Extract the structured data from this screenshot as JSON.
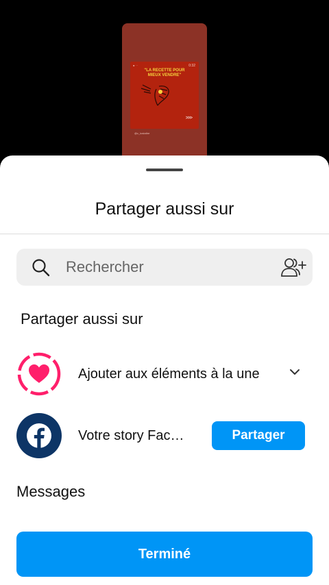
{
  "story_preview": {
    "time": "0:32",
    "headline_line1": "\"LA RECETTE POUR",
    "headline_line2": "MIEUX VENDRE\"",
    "arrows": ">>>",
    "handle": "@c_lustaltre"
  },
  "sheet": {
    "title": "Partager aussi sur",
    "search": {
      "placeholder": "Rechercher"
    },
    "section_heading": "Partager aussi sur",
    "highlights": {
      "label": "Ajouter aux éléments à la une",
      "accent": "#ff1f6b"
    },
    "facebook": {
      "label": "Votre story Facebook",
      "button_label": "Partager",
      "brand": "#0d3566"
    },
    "messages_heading": "Messages",
    "done_label": "Terminé",
    "primary_color": "#0095f6"
  }
}
